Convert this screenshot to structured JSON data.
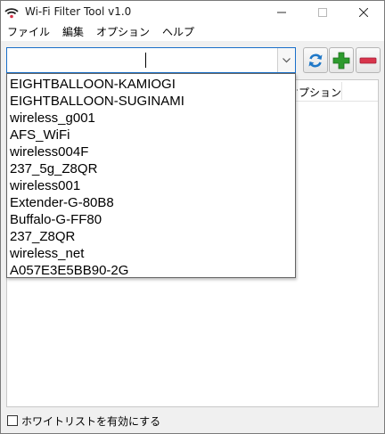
{
  "window": {
    "title": "Wi-Fi Filter Tool v1.0",
    "app_icon": "wifi-signal-icon"
  },
  "menu": [
    {
      "label": "ファイル"
    },
    {
      "label": "編集"
    },
    {
      "label": "オプション"
    },
    {
      "label": "ヘルプ"
    }
  ],
  "combo": {
    "value": "",
    "arrow_icon": "chevron-down-icon"
  },
  "toolbar": {
    "refresh_icon": "refresh-icon",
    "add_icon": "plus-icon",
    "remove_icon": "minus-icon"
  },
  "listview": {
    "column2_label": "オプション"
  },
  "dropdown": {
    "items": [
      "EIGHTBALLOON-KAMIOGI",
      "EIGHTBALLOON-SUGINAMI",
      "wireless_g001",
      "AFS_WiFi",
      "wireless004F",
      "237_5g_Z8QR",
      "wireless001",
      "Extender-G-80B8",
      "Buffalo-G-FF80",
      "237_Z8QR",
      "wireless_net",
      "A057E3E5BB90-2G"
    ]
  },
  "footer": {
    "whitelist_checkbox_label": "ホワイトリストを有効にする",
    "whitelist_checked": false
  },
  "colors": {
    "focus_border": "#1a6fc9",
    "refresh_blue": "#1f78c8",
    "add_green": "#2e9b2e",
    "remove_red": "#d8344b"
  }
}
